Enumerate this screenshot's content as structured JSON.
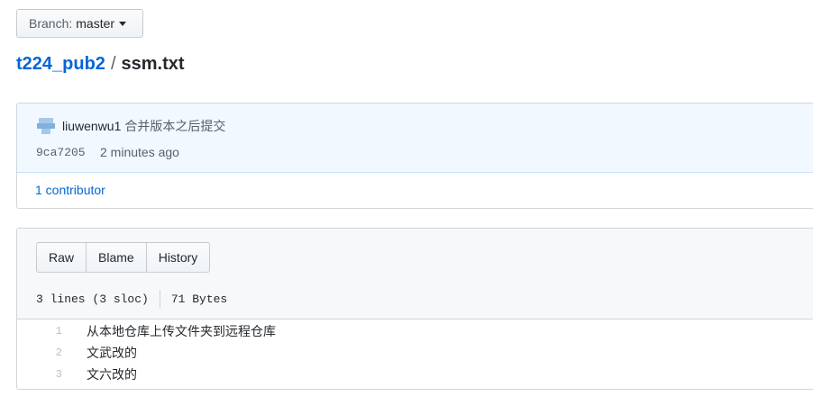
{
  "branch": {
    "label": "Branch:",
    "value": "master"
  },
  "breadcrumb": {
    "repo": "t224_pub2",
    "separator": "/",
    "file": "ssm.txt"
  },
  "commit": {
    "author": "liuwenwu1",
    "message": "合并版本之后提交",
    "sha": "9ca7205",
    "time": "2 minutes ago",
    "contributors": "1 contributor"
  },
  "file": {
    "actions": [
      "Raw",
      "Blame",
      "History"
    ],
    "lines_info": "3 lines (3 sloc)",
    "size": "71 Bytes",
    "lines": [
      {
        "num": "1",
        "text": "从本地仓库上传文件夹到远程仓库"
      },
      {
        "num": "2",
        "text": "文武改的"
      },
      {
        "num": "3",
        "text": "文六改的"
      }
    ]
  }
}
